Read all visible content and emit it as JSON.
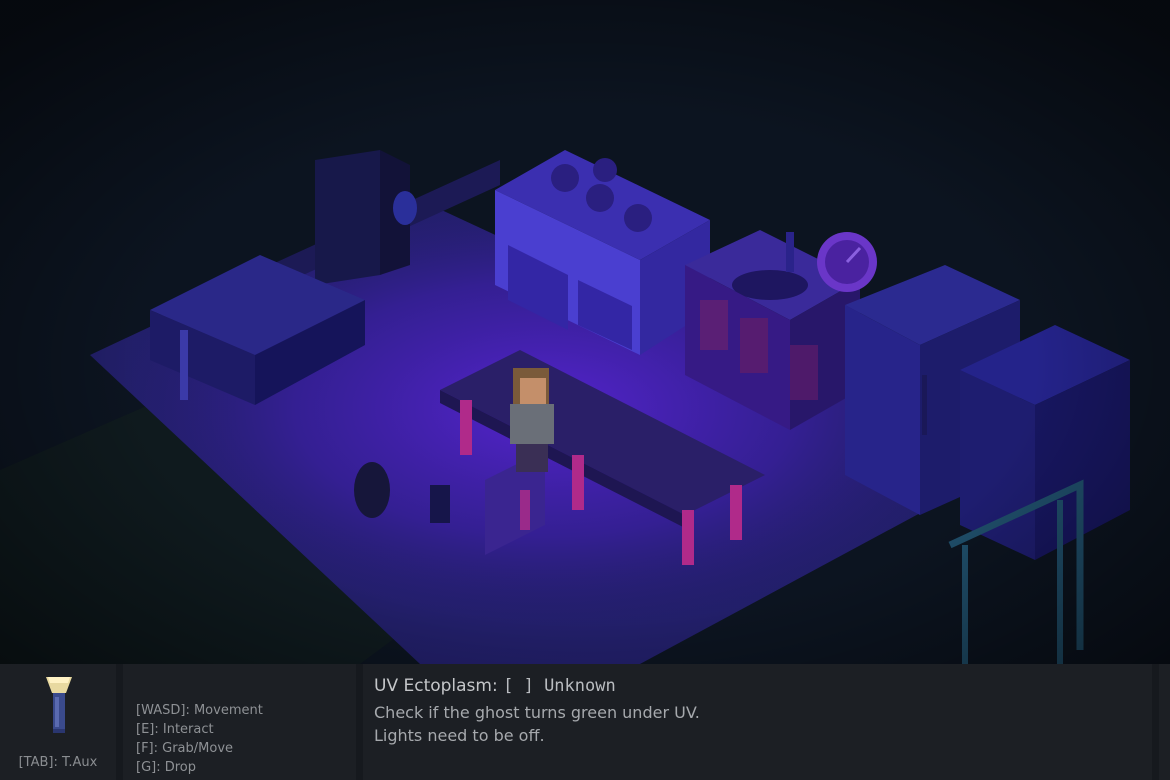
{
  "inventory": {
    "item_icon": "flashlight-icon",
    "tab_label": "[TAB]: T.Aux"
  },
  "controls": [
    "[WASD]: Movement",
    "[E]: Interact",
    "[F]: Grab/Move",
    "[G]: Drop"
  ],
  "evidence": {
    "title": "UV Ectoplasm:",
    "status": "[  ] Unknown",
    "line1": "Check if the ghost turns green under UV.",
    "line2": "Lights need to be off."
  },
  "colors": {
    "hud_background": "#1c1f24",
    "uv_light": "#4b1fd0",
    "ambient": "#0b121d"
  }
}
